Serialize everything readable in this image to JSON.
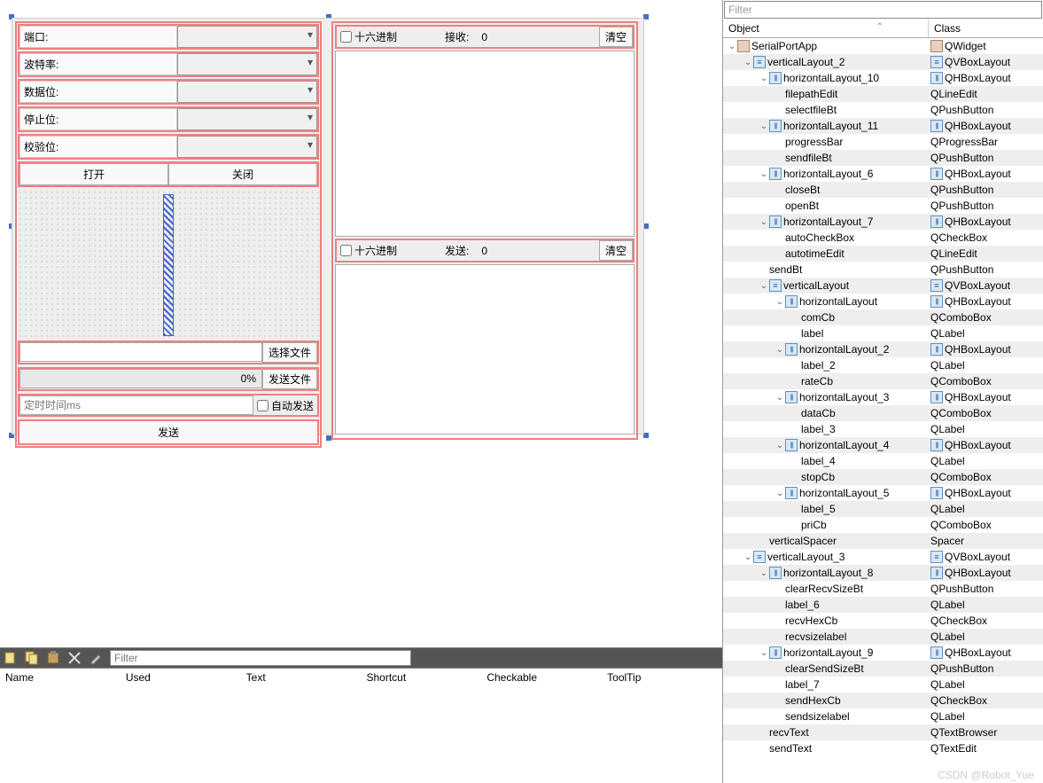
{
  "form": {
    "port_label": "端口:",
    "baud_label": "波特率:",
    "data_label": "数据位:",
    "stop_label": "停止位:",
    "parity_label": "校验位:",
    "open_btn": "打开",
    "close_btn": "关闭",
    "select_file_btn": "选择文件",
    "send_file_btn": "发送文件",
    "progress_text": "0%",
    "autotime_placeholder": "定时时间ms",
    "autosend_label": "自动发送",
    "send_btn": "发送",
    "hex_label": "十六进制",
    "recv_label": "接收:",
    "recv_count": "0",
    "clear_recv_btn": "清空",
    "send_label": "发送:",
    "send_count": "0",
    "clear_send_btn": "清空"
  },
  "action_panel": {
    "filter_placeholder": "Filter",
    "cols": [
      "Name",
      "Used",
      "Text",
      "Shortcut",
      "Checkable",
      "ToolTip"
    ]
  },
  "inspector": {
    "filter_placeholder": "Filter",
    "head_object": "Object",
    "head_class": "Class",
    "tree": [
      {
        "d": 0,
        "e": "v",
        "o": "SerialPortApp",
        "c": "QWidget",
        "io": "widget",
        "ic": "widget"
      },
      {
        "d": 1,
        "e": "v",
        "o": "verticalLayout_2",
        "c": "QVBoxLayout",
        "io": "vbox",
        "ic": "vbox"
      },
      {
        "d": 2,
        "e": "v",
        "o": "horizontalLayout_10",
        "c": "QHBoxLayout",
        "io": "hbox",
        "ic": "hbox"
      },
      {
        "d": 3,
        "e": "",
        "o": "filepathEdit",
        "c": "QLineEdit",
        "io": "",
        "ic": ""
      },
      {
        "d": 3,
        "e": "",
        "o": "selectfileBt",
        "c": "QPushButton",
        "io": "",
        "ic": ""
      },
      {
        "d": 2,
        "e": "v",
        "o": "horizontalLayout_11",
        "c": "QHBoxLayout",
        "io": "hbox",
        "ic": "hbox"
      },
      {
        "d": 3,
        "e": "",
        "o": "progressBar",
        "c": "QProgressBar",
        "io": "",
        "ic": ""
      },
      {
        "d": 3,
        "e": "",
        "o": "sendfileBt",
        "c": "QPushButton",
        "io": "",
        "ic": ""
      },
      {
        "d": 2,
        "e": "v",
        "o": "horizontalLayout_6",
        "c": "QHBoxLayout",
        "io": "hbox",
        "ic": "hbox"
      },
      {
        "d": 3,
        "e": "",
        "o": "closeBt",
        "c": "QPushButton",
        "io": "",
        "ic": ""
      },
      {
        "d": 3,
        "e": "",
        "o": "openBt",
        "c": "QPushButton",
        "io": "",
        "ic": ""
      },
      {
        "d": 2,
        "e": "v",
        "o": "horizontalLayout_7",
        "c": "QHBoxLayout",
        "io": "hbox",
        "ic": "hbox"
      },
      {
        "d": 3,
        "e": "",
        "o": "autoCheckBox",
        "c": "QCheckBox",
        "io": "",
        "ic": ""
      },
      {
        "d": 3,
        "e": "",
        "o": "autotimeEdit",
        "c": "QLineEdit",
        "io": "",
        "ic": ""
      },
      {
        "d": 2,
        "e": "",
        "o": "sendBt",
        "c": "QPushButton",
        "io": "",
        "ic": ""
      },
      {
        "d": 2,
        "e": "v",
        "o": "verticalLayout",
        "c": "QVBoxLayout",
        "io": "vbox",
        "ic": "vbox"
      },
      {
        "d": 3,
        "e": "v",
        "o": "horizontalLayout",
        "c": "QHBoxLayout",
        "io": "hbox",
        "ic": "hbox"
      },
      {
        "d": 4,
        "e": "",
        "o": "comCb",
        "c": "QComboBox",
        "io": "",
        "ic": ""
      },
      {
        "d": 4,
        "e": "",
        "o": "label",
        "c": "QLabel",
        "io": "",
        "ic": ""
      },
      {
        "d": 3,
        "e": "v",
        "o": "horizontalLayout_2",
        "c": "QHBoxLayout",
        "io": "hbox",
        "ic": "hbox"
      },
      {
        "d": 4,
        "e": "",
        "o": "label_2",
        "c": "QLabel",
        "io": "",
        "ic": ""
      },
      {
        "d": 4,
        "e": "",
        "o": "rateCb",
        "c": "QComboBox",
        "io": "",
        "ic": ""
      },
      {
        "d": 3,
        "e": "v",
        "o": "horizontalLayout_3",
        "c": "QHBoxLayout",
        "io": "hbox",
        "ic": "hbox"
      },
      {
        "d": 4,
        "e": "",
        "o": "dataCb",
        "c": "QComboBox",
        "io": "",
        "ic": ""
      },
      {
        "d": 4,
        "e": "",
        "o": "label_3",
        "c": "QLabel",
        "io": "",
        "ic": ""
      },
      {
        "d": 3,
        "e": "v",
        "o": "horizontalLayout_4",
        "c": "QHBoxLayout",
        "io": "hbox",
        "ic": "hbox"
      },
      {
        "d": 4,
        "e": "",
        "o": "label_4",
        "c": "QLabel",
        "io": "",
        "ic": ""
      },
      {
        "d": 4,
        "e": "",
        "o": "stopCb",
        "c": "QComboBox",
        "io": "",
        "ic": ""
      },
      {
        "d": 3,
        "e": "v",
        "o": "horizontalLayout_5",
        "c": "QHBoxLayout",
        "io": "hbox",
        "ic": "hbox"
      },
      {
        "d": 4,
        "e": "",
        "o": "label_5",
        "c": "QLabel",
        "io": "",
        "ic": ""
      },
      {
        "d": 4,
        "e": "",
        "o": "priCb",
        "c": "QComboBox",
        "io": "",
        "ic": ""
      },
      {
        "d": 2,
        "e": "",
        "o": "verticalSpacer",
        "c": "Spacer",
        "io": "",
        "ic": ""
      },
      {
        "d": 1,
        "e": "v",
        "o": "verticalLayout_3",
        "c": "QVBoxLayout",
        "io": "vbox",
        "ic": "vbox"
      },
      {
        "d": 2,
        "e": "v",
        "o": "horizontalLayout_8",
        "c": "QHBoxLayout",
        "io": "hbox",
        "ic": "hbox"
      },
      {
        "d": 3,
        "e": "",
        "o": "clearRecvSizeBt",
        "c": "QPushButton",
        "io": "",
        "ic": ""
      },
      {
        "d": 3,
        "e": "",
        "o": "label_6",
        "c": "QLabel",
        "io": "",
        "ic": ""
      },
      {
        "d": 3,
        "e": "",
        "o": "recvHexCb",
        "c": "QCheckBox",
        "io": "",
        "ic": ""
      },
      {
        "d": 3,
        "e": "",
        "o": "recvsizelabel",
        "c": "QLabel",
        "io": "",
        "ic": ""
      },
      {
        "d": 2,
        "e": "v",
        "o": "horizontalLayout_9",
        "c": "QHBoxLayout",
        "io": "hbox",
        "ic": "hbox"
      },
      {
        "d": 3,
        "e": "",
        "o": "clearSendSizeBt",
        "c": "QPushButton",
        "io": "",
        "ic": ""
      },
      {
        "d": 3,
        "e": "",
        "o": "label_7",
        "c": "QLabel",
        "io": "",
        "ic": ""
      },
      {
        "d": 3,
        "e": "",
        "o": "sendHexCb",
        "c": "QCheckBox",
        "io": "",
        "ic": ""
      },
      {
        "d": 3,
        "e": "",
        "o": "sendsizelabel",
        "c": "QLabel",
        "io": "",
        "ic": ""
      },
      {
        "d": 2,
        "e": "",
        "o": "recvText",
        "c": "QTextBrowser",
        "io": "",
        "ic": ""
      },
      {
        "d": 2,
        "e": "",
        "o": "sendText",
        "c": "QTextEdit",
        "io": "",
        "ic": ""
      }
    ]
  },
  "watermark": "CSDN @Robot_Yue"
}
